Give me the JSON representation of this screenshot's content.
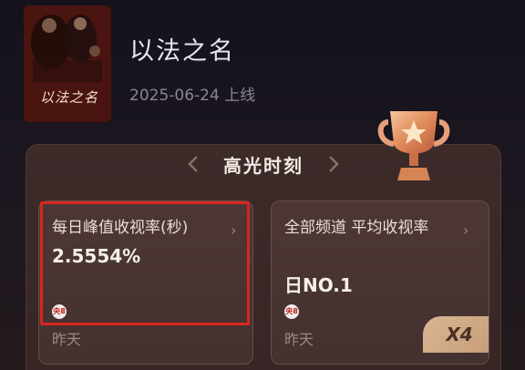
{
  "show": {
    "title": "以法之名",
    "release_date": "2025-06-24",
    "release_suffix": "上线",
    "poster_title": "以法之名"
  },
  "highlights": {
    "title": "高光时刻",
    "cards": [
      {
        "label": "每日峰值收视率(秒)",
        "value": "2.5554%",
        "channel": "央8",
        "time": "昨天"
      },
      {
        "label": "全部频道 平均收视率",
        "value": "日NO.1",
        "channel": "央8",
        "time": "昨天",
        "badge": "X4"
      }
    ]
  },
  "icons": {
    "chevron": "chevron-right-icon",
    "trophy": "trophy-icon",
    "channel": "cctv8-logo-icon"
  },
  "colors": {
    "background": "#17141f",
    "panel": "#3d2b2a",
    "card": "#4d3735",
    "highlight_border": "#d8261e",
    "badge": "#d9b794"
  }
}
